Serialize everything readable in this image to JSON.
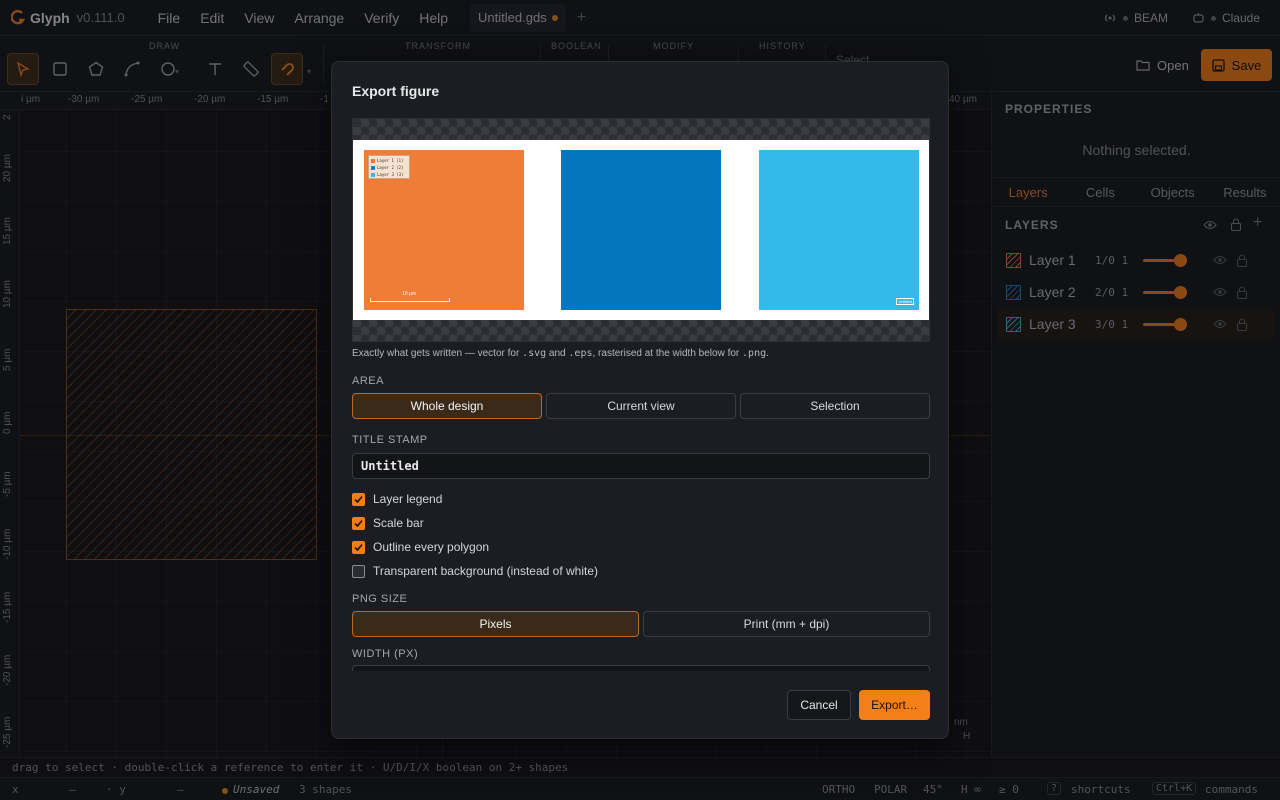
{
  "app": {
    "name": "Glyph",
    "version": "v0.111.0"
  },
  "menus": [
    "File",
    "Edit",
    "View",
    "Arrange",
    "Verify",
    "Help"
  ],
  "document_tab": {
    "name": "Untitled.gds",
    "add": "+"
  },
  "connections": {
    "beam": "BEAM",
    "assistant": "Claude"
  },
  "toolbar": {
    "groups": {
      "draw": "DRAW",
      "transform": "TRANSFORM",
      "boolean": "BOOLEAN",
      "modify": "MODIFY",
      "history": "HISTORY"
    },
    "select_hint": "Select",
    "open_label": "Open",
    "save_label": "Save"
  },
  "ruler": {
    "top": [
      "i µm",
      "-30 µm",
      "-25 µm",
      "-20 µm",
      "-15 µm",
      "-1",
      "40 µm"
    ],
    "left": [
      "2",
      "20 µm",
      "15 µm",
      "10 µm",
      "5 µm",
      "0 µm",
      "-5 µm",
      "-10 µm",
      "-15 µm",
      "-20 µm",
      "-25 µm"
    ],
    "unit_box": [
      "nm",
      "H"
    ]
  },
  "panel": {
    "properties_title": "PROPERTIES",
    "properties_empty": "Nothing selected.",
    "tabs": [
      "Layers",
      "Cells",
      "Objects",
      "Results"
    ],
    "layers_title": "LAYERS",
    "layers": [
      {
        "name": "Layer 1",
        "num": "1/0",
        "z": "1",
        "color": "#e9783a",
        "opacity": 1
      },
      {
        "name": "Layer 2",
        "num": "2/0",
        "z": "1",
        "color": "#1a7fc4",
        "opacity": 1
      },
      {
        "name": "Layer 3",
        "num": "3/0",
        "z": "1",
        "color": "#3bb5e8",
        "opacity": 1
      }
    ]
  },
  "modal": {
    "title": "Export figure",
    "preview": {
      "legend": [
        "Layer 1 (1)",
        "Layer 2 (2)",
        "Layer 3 (3)"
      ],
      "scalebar": "10 µm",
      "stamp": "Untitled",
      "tile_colors": [
        "#ef7c37",
        "#0277bd",
        "#34b9eb"
      ]
    },
    "caption_parts": [
      "Exactly what gets written — vector for ",
      ".svg",
      " and ",
      ".eps",
      ", rasterised at the width below for ",
      ".png",
      "."
    ],
    "area_label": "AREA",
    "area_options": [
      "Whole design",
      "Current view",
      "Selection"
    ],
    "area_selected": 0,
    "title_stamp_label": "TITLE STAMP",
    "title_stamp_value": "Untitled",
    "checks": [
      {
        "label": "Layer legend",
        "checked": true
      },
      {
        "label": "Scale bar",
        "checked": true
      },
      {
        "label": "Outline every polygon",
        "checked": true
      },
      {
        "label": "Transparent background (instead of white)",
        "checked": false
      }
    ],
    "png_size_label": "PNG SIZE",
    "png_size_options": [
      "Pixels",
      "Print (mm + dpi)"
    ],
    "png_size_selected": 0,
    "width_label": "WIDTH (PX)",
    "cancel_label": "Cancel",
    "export_label": "Export…"
  },
  "hint": "drag to select · double-click a reference to enter it · U/D/I/X boolean on 2+ shapes",
  "status": {
    "x": "x",
    "x_val": "—",
    "y": "· y",
    "y_val": "—",
    "unsaved": "Unsaved",
    "shapes": "3 shapes",
    "ortho": "ORTHO",
    "polar": "POLAR",
    "angle": "45°",
    "h": "H ∞",
    "ge": "≥ 0",
    "shortcuts_key": "?",
    "shortcuts": "shortcuts",
    "commands_key": "Ctrl+K",
    "commands": "commands"
  }
}
